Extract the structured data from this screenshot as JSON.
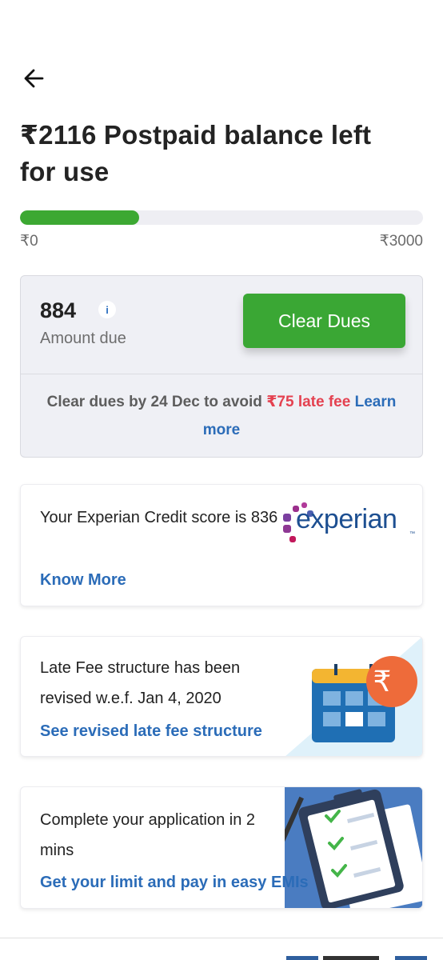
{
  "header": {
    "back_icon": "back-arrow-icon",
    "title": "₹2116 Postpaid balance left for use"
  },
  "balance": {
    "min_label": "₹0",
    "max_label": "₹3000",
    "used_fraction": 0.295,
    "bar_color": "#3ca832"
  },
  "dues": {
    "amount": "884",
    "info_icon": "i",
    "label": "Amount due",
    "button_label": "Clear Dues",
    "note_prefix": "Clear dues by 24 Dec to avoid ",
    "note_fee": "₹75 late fee",
    "note_link": "Learn more"
  },
  "credit_card": {
    "text": "Your Experian Credit score is 836",
    "link": "Know More",
    "logo_text": "experian",
    "logo_tm": "™"
  },
  "fee_card": {
    "text": "Late Fee structure has been revised w.e.f. Jan 4, 2020",
    "link": "See revised late fee structure",
    "badge_symbol": "₹"
  },
  "application_card": {
    "text": "Complete your application in 2 mins",
    "link": "Get your limit and pay in easy EMIs"
  },
  "colors": {
    "accent_green": "#3aa734",
    "link_blue": "#2b6cb8",
    "fee_red": "#e44150"
  }
}
